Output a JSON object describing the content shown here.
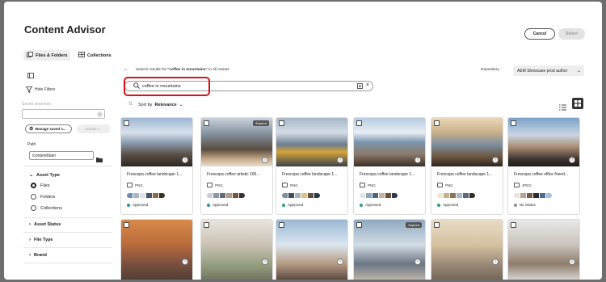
{
  "title": "Content Advisor",
  "buttons": {
    "cancel": "Cancel",
    "select": "Select"
  },
  "sidebar": {
    "tabs": [
      {
        "label": "Files & Folders",
        "icon": "files-icon"
      },
      {
        "label": "Collections",
        "icon": "collections-icon"
      }
    ],
    "hide_filters": "Hide Filters",
    "saved_searches_label": "Saved searches",
    "manage_saved": "Manage saved s...",
    "update": "Update s...",
    "path_label": "Path",
    "path_value": "/content/dam",
    "facets": {
      "asset_type": "Asset Type",
      "options": [
        "Files",
        "Folders",
        "Collections"
      ],
      "selected": "Files",
      "asset_status": "Asset Status",
      "file_type": "File Type",
      "brand": "Brand"
    }
  },
  "results": {
    "prefix": "Search results for ",
    "query_quoted": "\"coffee in mountains\"",
    "suffix": " in All Assets"
  },
  "repository": {
    "label": "Repository",
    "value": "AEM Showcase prod author"
  },
  "search": {
    "value": "coffee in mountains"
  },
  "sort": {
    "label": "Sort by",
    "value": "Relevance"
  },
  "colors": {
    "approved": "#2d9d78",
    "no_status": "#8e8e8e",
    "highlight": "#d4141a"
  },
  "cards": [
    {
      "name": "Frescopa coffee landscape 1...",
      "type": "PNG",
      "status": "Approved",
      "expired": false,
      "swatches": [
        "#6f8db4",
        "#a9b6c6",
        "#dfe3e8",
        "#4a5663",
        "#8a6a52",
        "#3c2e27"
      ]
    },
    {
      "name": "Frescopa coffee artistic 100...",
      "type": "PNG",
      "status": "Approved",
      "expired": true,
      "swatches": [
        "#c9cfd6",
        "#8a96a3",
        "#5e6b78",
        "#b09a85",
        "#6d5646",
        "#3a3330"
      ]
    },
    {
      "name": "Frescopa coffee landscape 1...",
      "type": "PNG",
      "status": "Approved",
      "expired": false,
      "swatches": [
        "#7d8c9b",
        "#3e4d5a",
        "#a4b3c0",
        "#e0c280",
        "#5a5240",
        "#2c3640"
      ]
    },
    {
      "name": "Frescopa coffee landscape 1...",
      "type": "PNG",
      "status": "Approved",
      "expired": false,
      "swatches": [
        "#dfe6ec",
        "#8fa3b8",
        "#4f6478",
        "#c2b29e",
        "#6b4e3a",
        "#2f3845"
      ]
    },
    {
      "name": "Frescopa coffee landscape 1...",
      "type": "PNG",
      "status": "Approved",
      "expired": false,
      "swatches": [
        "#efe6d4",
        "#c5b08c",
        "#8a7356",
        "#a7b6c4",
        "#5b6a7a",
        "#3a2f26"
      ]
    },
    {
      "name": "Frescopa coffee office friend...",
      "type": "JPEG",
      "status": "No Status",
      "expired": false,
      "swatches": [
        "#e8e3dc",
        "#b6a48f",
        "#6e5b4a",
        "#2f2a27",
        "#4d6b8f",
        "#a7c0d8"
      ]
    }
  ],
  "cards_row2": [
    {
      "expired": false
    },
    {
      "expired": false
    },
    {
      "expired": false
    },
    {
      "expired": true
    },
    {
      "expired": false
    },
    {
      "expired": false
    }
  ]
}
